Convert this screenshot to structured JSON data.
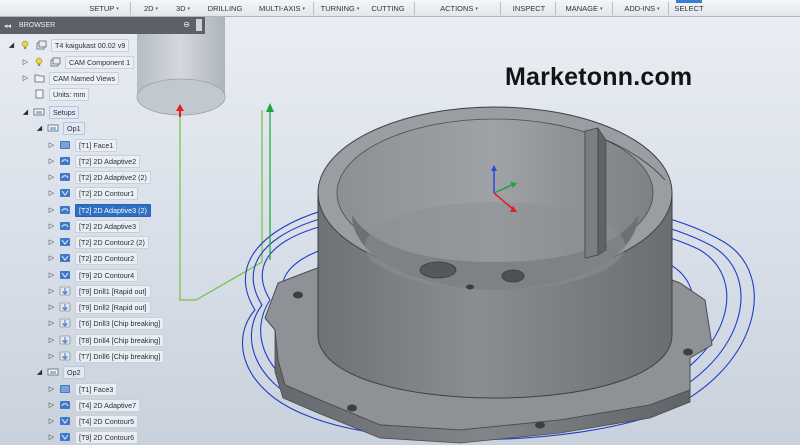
{
  "toolbar": {
    "items": [
      {
        "label": "SETUP",
        "caret": "▾"
      },
      {
        "label": "2D",
        "caret": "▾"
      },
      {
        "label": "3D",
        "caret": "▾"
      },
      {
        "label": "DRILLING",
        "caret": ""
      },
      {
        "label": "MULTI-AXIS",
        "caret": "▾"
      },
      {
        "label": "TURNING",
        "caret": "▾"
      },
      {
        "label": "CUTTING",
        "caret": ""
      },
      {
        "label": "ACTIONS",
        "caret": "▾"
      },
      {
        "label": "INSPECT",
        "caret": ""
      },
      {
        "label": "MANAGE",
        "caret": "▾"
      },
      {
        "label": "ADD-INS",
        "caret": "▾"
      },
      {
        "label": "SELECT",
        "caret": ""
      }
    ]
  },
  "browser": {
    "title": "BROWSER",
    "collapse_glyph": "◂◂",
    "rows": [
      {
        "label": "T4 kaigukast 00.02 v9",
        "icon": "component-icon",
        "bulb": true,
        "tri": "◢",
        "style": "plain"
      },
      {
        "label": "CAM Component 1",
        "icon": "component-icon",
        "bulb": true,
        "tri": "▷",
        "style": "normal"
      },
      {
        "label": "CAM Named Views",
        "icon": "folder-icon",
        "bulb": false,
        "tri": "▷",
        "style": "normal"
      },
      {
        "label": "Units: mm",
        "icon": "document-icon",
        "bulb": false,
        "tri": "",
        "style": "normal"
      },
      {
        "label": "Setups",
        "icon": "setup-icon",
        "bulb": false,
        "tri": "◢",
        "style": "group"
      },
      {
        "label": "Op1",
        "icon": "setup-icon",
        "bulb": false,
        "tri": "◢",
        "style": "group"
      },
      {
        "label": "[T1] Face1",
        "icon": "face-icon",
        "bulb": false,
        "tri": "▷",
        "style": "normal"
      },
      {
        "label": "[T2] 2D Adaptive2",
        "icon": "adaptive-icon",
        "bulb": false,
        "tri": "▷",
        "style": "normal"
      },
      {
        "label": "[T2] 2D Adaptive2 (2)",
        "icon": "adaptive-icon",
        "bulb": false,
        "tri": "▷",
        "style": "normal"
      },
      {
        "label": "[T2] 2D Contour1",
        "icon": "contour-icon",
        "bulb": false,
        "tri": "▷",
        "style": "normal"
      },
      {
        "label": "[T2] 2D Adaptive3 (2)",
        "icon": "adaptive-icon",
        "bulb": false,
        "tri": "▷",
        "style": "selected"
      },
      {
        "label": "[T2] 2D Adaptive3",
        "icon": "adaptive-icon",
        "bulb": false,
        "tri": "▷",
        "style": "normal"
      },
      {
        "label": "[T2] 2D Contour2 (2)",
        "icon": "contour-icon",
        "bulb": false,
        "tri": "▷",
        "style": "normal"
      },
      {
        "label": "[T2] 2D Contour2",
        "icon": "contour-icon",
        "bulb": false,
        "tri": "▷",
        "style": "normal"
      },
      {
        "label": "[T9] 2D Contour4",
        "icon": "contour-icon",
        "bulb": false,
        "tri": "▷",
        "style": "normal"
      },
      {
        "label": "[T9] Drill1 [Rapid out]",
        "icon": "drill-icon",
        "bulb": false,
        "tri": "▷",
        "style": "normal"
      },
      {
        "label": "[T9] Drill2 [Rapid out]",
        "icon": "drill-icon",
        "bulb": false,
        "tri": "▷",
        "style": "normal"
      },
      {
        "label": "[T6] Drill3 [Chip breaking]",
        "icon": "drill-icon",
        "bulb": false,
        "tri": "▷",
        "style": "normal"
      },
      {
        "label": "[T8] Drill4 [Chip breaking]",
        "icon": "drill-icon",
        "bulb": false,
        "tri": "▷",
        "style": "normal"
      },
      {
        "label": "[T7] Drill6 [Chip breaking]",
        "icon": "drill-icon",
        "bulb": false,
        "tri": "▷",
        "style": "normal"
      },
      {
        "label": "Op2",
        "icon": "setup-icon",
        "bulb": false,
        "tri": "◢",
        "style": "group"
      },
      {
        "label": "[T1] Face3",
        "icon": "face-icon",
        "bulb": false,
        "tri": "▷",
        "style": "normal"
      },
      {
        "label": "[T4] 2D Adaptive7",
        "icon": "adaptive-icon",
        "bulb": false,
        "tri": "▷",
        "style": "normal"
      },
      {
        "label": "[T4] 2D Contour5",
        "icon": "contour-icon",
        "bulb": false,
        "tri": "▷",
        "style": "normal"
      },
      {
        "label": "[T9] 2D Contour6",
        "icon": "contour-icon",
        "bulb": false,
        "tri": "▷",
        "style": "normal"
      }
    ]
  },
  "watermark": "Marketonn.com",
  "colors": {
    "toolpath": "#1f3fc4",
    "axis_x": "#e01f1f",
    "axis_y": "#1fa33a",
    "axis_z": "#2a48e0",
    "part": "#7c7f83",
    "selection": "#2f6fc2"
  }
}
